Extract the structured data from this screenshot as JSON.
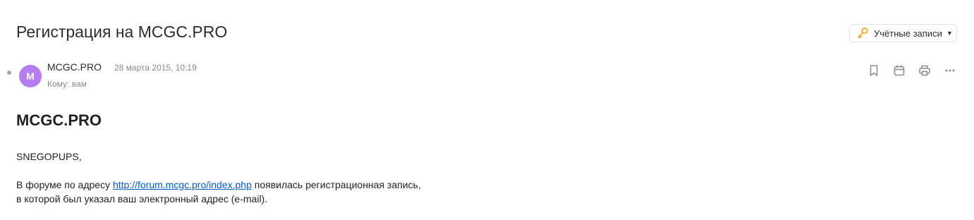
{
  "top_clipped_text": "• ∙ · · • · · · • · · · · · · • · · · ·",
  "subject": "Регистрация на MCGC.PRO",
  "accounts_button": {
    "label": "Учётные записи",
    "icon": "key-icon"
  },
  "sender": {
    "avatar_letter": "M",
    "avatar_color": "#b67cf2",
    "name": "MCGC.PRO",
    "date": "28 марта 2015, 10:19",
    "recipient": "Кому: вам"
  },
  "actions": [
    {
      "icon": "bookmark-icon"
    },
    {
      "icon": "calendar-icon"
    },
    {
      "icon": "print-icon"
    },
    {
      "icon": "more-icon"
    }
  ],
  "body": {
    "title": "MCGC.PRO",
    "greeting": "SNEGOPUPS,",
    "para1_before": "В форуме по адресу ",
    "link": "http://forum.mcgc.pro/index.php",
    "para1_after": " появилась регистрационная запись,",
    "para2": "в которой был указал ваш электронный адрес (e-mail)."
  },
  "colors": {
    "accent_key": "#f5a623",
    "link": "#005bd1",
    "muted": "#87898f"
  }
}
